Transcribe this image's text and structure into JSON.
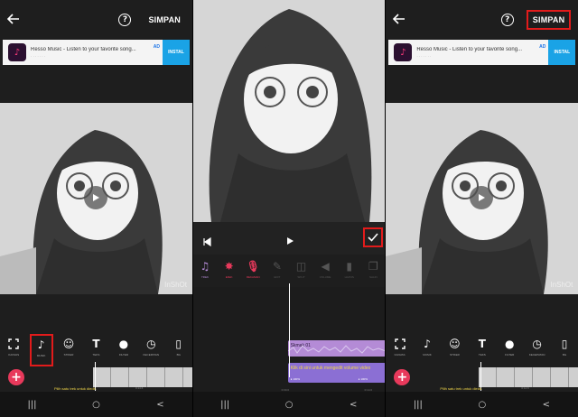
{
  "left": {
    "save_label": "SIMPAN",
    "help_icon": "?",
    "ad": {
      "title": "Resso Music - Listen to your favorite song...",
      "subtitle": "· · · · · · ·",
      "badge": "AD",
      "install": "INSTAL"
    },
    "watermark": "InShOt",
    "tools": [
      {
        "icon": "crop-icon",
        "label": "KANVAS"
      },
      {
        "icon": "music-icon",
        "label": "MUSIK"
      },
      {
        "icon": "sticker-icon",
        "label": "STIKER"
      },
      {
        "icon": "text-icon",
        "label": "TEKS"
      },
      {
        "icon": "filter-icon",
        "label": "FILTER"
      },
      {
        "icon": "speed-icon",
        "label": "KECEPATAN"
      },
      {
        "icon": "background-icon",
        "label": "BG"
      }
    ],
    "hint": "Pilih satu trek untuk diedit.",
    "time_start": "0:00.0",
    "time_end": "0:14.6"
  },
  "middle": {
    "tools": [
      {
        "icon": "music-note-icon",
        "label": "TREK"
      },
      {
        "icon": "effect-icon",
        "label": "EFEK"
      },
      {
        "icon": "mic-icon",
        "label": "REKAMAN"
      },
      {
        "icon": "edit-icon",
        "label": "EDIT"
      },
      {
        "icon": "split-icon",
        "label": "SPLIT"
      },
      {
        "icon": "volume-icon",
        "label": "VOLUME"
      },
      {
        "icon": "delete-icon",
        "label": "HAPUS"
      },
      {
        "icon": "copy-icon",
        "label": "SALIN"
      }
    ],
    "track1": "Skmak 01",
    "track2": "Klik di sini untuk mengedit volume video",
    "track2_vol_left": "● 100%",
    "track2_vol_right": "● 100%",
    "time_start": "0:00.0",
    "time_end": "0:14.6"
  },
  "right": {
    "save_label": "SIMPAN",
    "help_icon": "?",
    "ad": {
      "title": "Resso Music - Listen to your favorite song...",
      "subtitle": "· · · · · · ·",
      "badge": "AD",
      "install": "INSTAL"
    },
    "watermark": "InShOt",
    "tools": [
      {
        "icon": "crop-icon",
        "label": "KANVAS"
      },
      {
        "icon": "music-icon",
        "label": "MUSIK"
      },
      {
        "icon": "sticker-icon",
        "label": "STIKER"
      },
      {
        "icon": "text-icon",
        "label": "TEKS"
      },
      {
        "icon": "filter-icon",
        "label": "FILTER"
      },
      {
        "icon": "speed-icon",
        "label": "KECEPATAN"
      },
      {
        "icon": "background-icon",
        "label": "BG"
      }
    ],
    "hint": "Pilih satu trek untuk diedit.",
    "time_start": "0:00.0",
    "time_end": "0:14.6"
  },
  "colors": {
    "highlight": "#e21b1b",
    "add_button": "#e8395b",
    "track_music": "#b48bd6",
    "track_video": "#8b6fd4",
    "hint_text": "#f0d64a"
  }
}
